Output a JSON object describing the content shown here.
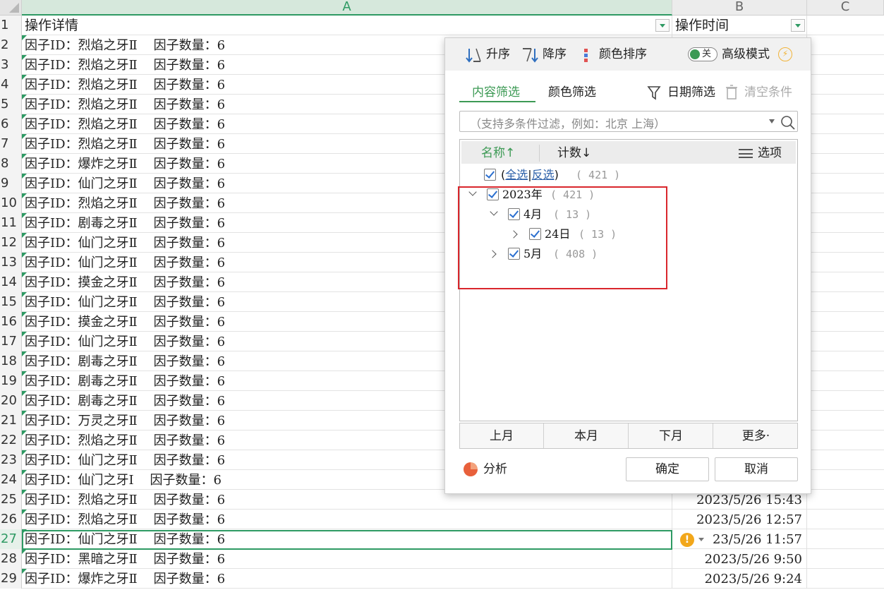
{
  "sheet": {
    "columns": [
      "A",
      "B",
      "C"
    ],
    "header_row": {
      "num": "1",
      "a": "操作详情",
      "b": "操作时间"
    },
    "rows": [
      {
        "num": "2",
        "a": "因子ID：烈焰之牙Ⅱ    因子数量：6",
        "b": ""
      },
      {
        "num": "3",
        "a": "因子ID：烈焰之牙Ⅱ    因子数量：6",
        "b": ""
      },
      {
        "num": "4",
        "a": "因子ID：烈焰之牙Ⅱ    因子数量：6",
        "b": ""
      },
      {
        "num": "5",
        "a": "因子ID：烈焰之牙Ⅱ    因子数量：6",
        "b": ""
      },
      {
        "num": "6",
        "a": "因子ID：烈焰之牙Ⅱ    因子数量：6",
        "b": ""
      },
      {
        "num": "7",
        "a": "因子ID：烈焰之牙Ⅱ    因子数量：6",
        "b": ""
      },
      {
        "num": "8",
        "a": "因子ID：爆炸之牙Ⅱ    因子数量：6",
        "b": ""
      },
      {
        "num": "9",
        "a": "因子ID：仙门之牙Ⅱ    因子数量：6",
        "b": ""
      },
      {
        "num": "10",
        "a": "因子ID：烈焰之牙Ⅱ    因子数量：6",
        "b": ""
      },
      {
        "num": "11",
        "a": "因子ID：剧毒之牙Ⅱ    因子数量：6",
        "b": ""
      },
      {
        "num": "12",
        "a": "因子ID：仙门之牙Ⅱ    因子数量：6",
        "b": ""
      },
      {
        "num": "13",
        "a": "因子ID：仙门之牙Ⅱ    因子数量：6",
        "b": ""
      },
      {
        "num": "14",
        "a": "因子ID：摸金之牙Ⅱ    因子数量：6",
        "b": ""
      },
      {
        "num": "15",
        "a": "因子ID：仙门之牙Ⅱ    因子数量：6",
        "b": ""
      },
      {
        "num": "16",
        "a": "因子ID：摸金之牙Ⅱ    因子数量：6",
        "b": ""
      },
      {
        "num": "17",
        "a": "因子ID：仙门之牙Ⅱ    因子数量：6",
        "b": ""
      },
      {
        "num": "18",
        "a": "因子ID：剧毒之牙Ⅱ    因子数量：6",
        "b": ""
      },
      {
        "num": "19",
        "a": "因子ID：剧毒之牙Ⅱ    因子数量：6",
        "b": ""
      },
      {
        "num": "20",
        "a": "因子ID：剧毒之牙Ⅱ    因子数量：6",
        "b": ""
      },
      {
        "num": "21",
        "a": "因子ID：万灵之牙Ⅱ    因子数量：6",
        "b": ""
      },
      {
        "num": "22",
        "a": "因子ID：烈焰之牙Ⅱ    因子数量：6",
        "b": ""
      },
      {
        "num": "23",
        "a": "因子ID：仙门之牙Ⅱ    因子数量：6",
        "b": ""
      },
      {
        "num": "24",
        "a": "因子ID：仙门之牙Ⅰ    因子数量：6",
        "b": ""
      },
      {
        "num": "25",
        "a": "因子ID：烈焰之牙Ⅱ    因子数量：6",
        "b": "2023/5/26 15:43"
      },
      {
        "num": "26",
        "a": "因子ID：烈焰之牙Ⅱ    因子数量：6",
        "b": "2023/5/26 12:57"
      },
      {
        "num": "27",
        "a": "因子ID：仙门之牙Ⅱ    因子数量：6",
        "b": "23/5/26 11:57"
      },
      {
        "num": "28",
        "a": "因子ID：黑暗之牙Ⅱ    因子数量：6",
        "b": "2023/5/26 9:50"
      },
      {
        "num": "29",
        "a": "因子ID：爆炸之牙Ⅱ    因子数量：6",
        "b": "2023/5/26 9:24"
      }
    ],
    "warning_icon": "!"
  },
  "filter": {
    "sort": {
      "asc": "升序",
      "desc": "降序",
      "color": "颜色排序"
    },
    "advanced": {
      "toggle": "关",
      "label": "高级模式",
      "icon": "lightning-icon"
    },
    "tabs": {
      "content": "内容筛选",
      "color": "颜色筛选"
    },
    "date_filter": "日期筛选",
    "clear": "清空条件",
    "search_placeholder": "（支持多条件过滤，例如：北京 上海）",
    "list_header": {
      "name": "名称↑",
      "count": "计数↓",
      "options": "选项"
    },
    "select_all": {
      "open": "(",
      "all": "全选",
      "sep": "|",
      "invert": "反选",
      "close": ")",
      "count": "( 421 )"
    },
    "tree": [
      {
        "label": "2023年",
        "count": "( 421 )"
      },
      {
        "label": "4月",
        "count": "( 13 )"
      },
      {
        "label": "24日",
        "count": "( 13 )"
      },
      {
        "label": "5月",
        "count": "( 408 )"
      }
    ],
    "months": [
      "上月",
      "本月",
      "下月",
      "更多·"
    ],
    "analyze": "分析",
    "ok": "确定",
    "cancel": "取消",
    "colors": {
      "accent": "#3d9a55",
      "highlight": "#d9262c",
      "check": "#2b6fcf"
    }
  }
}
